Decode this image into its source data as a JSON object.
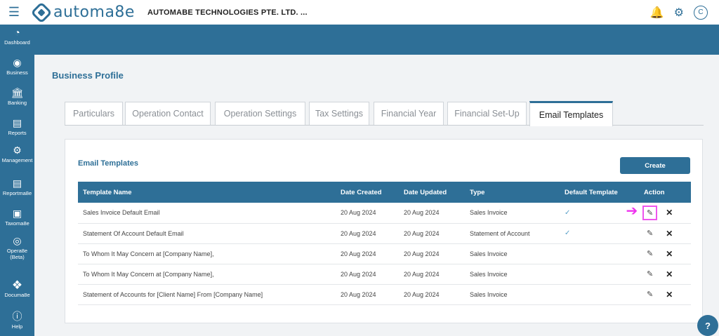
{
  "header": {
    "brand": "automa8e",
    "company": "AUTOMABE TECHNOLOGIES PTE. LTD. ...",
    "avatar_initial": "C"
  },
  "sidebar": {
    "items": [
      {
        "label": "Dashboard",
        "icon": "pie-chart-icon"
      },
      {
        "label": "Business",
        "icon": "business-icon"
      },
      {
        "label": "Banking",
        "icon": "bank-icon"
      },
      {
        "label": "Reports",
        "icon": "report-icon"
      },
      {
        "label": "Management",
        "icon": "gear-icon"
      },
      {
        "label": "Reportma8e",
        "icon": "reportma8e-icon"
      },
      {
        "label": "Taxoma8e",
        "icon": "taxoma8e-icon"
      },
      {
        "label": "Opera8e (Beta)",
        "icon": "opera8e-icon"
      },
      {
        "label": "Documa8e",
        "icon": "documa8e-icon"
      },
      {
        "label": "Help",
        "icon": "help-icon"
      }
    ]
  },
  "page": {
    "title": "Business Profile"
  },
  "tabs": [
    {
      "label": "Particulars"
    },
    {
      "label": "Operation Contact"
    },
    {
      "label": "Operation Settings"
    },
    {
      "label": "Tax Settings"
    },
    {
      "label": "Financial Year"
    },
    {
      "label": "Financial Set-Up"
    },
    {
      "label": "Email Templates",
      "active": true
    }
  ],
  "card": {
    "title": "Email Templates",
    "create_label": "Create"
  },
  "table": {
    "headers": [
      "Template Name",
      "Date Created",
      "Date Updated",
      "Type",
      "Default Template",
      "Action"
    ],
    "rows": [
      {
        "name": "Sales Invoice Default Email",
        "created": "20 Aug 2024",
        "updated": "20 Aug 2024",
        "type": "Sales Invoice",
        "default": true
      },
      {
        "name": "Statement Of Account Default Email",
        "created": "20 Aug 2024",
        "updated": "20 Aug 2024",
        "type": "Statement of Account",
        "default": true
      },
      {
        "name": "To Whom It May Concern at [Company Name],",
        "created": "20 Aug 2024",
        "updated": "20 Aug 2024",
        "type": "Sales Invoice",
        "default": false
      },
      {
        "name": "To Whom It May Concern at [Company Name],",
        "created": "20 Aug 2024",
        "updated": "20 Aug 2024",
        "type": "Sales Invoice",
        "default": false
      },
      {
        "name": "Statement of Accounts for [Client Name] From [Company Name]",
        "created": "20 Aug 2024",
        "updated": "20 Aug 2024",
        "type": "Sales Invoice",
        "default": false
      }
    ]
  },
  "colors": {
    "brand": "#2e6f97",
    "highlight": "#ee55ee"
  }
}
